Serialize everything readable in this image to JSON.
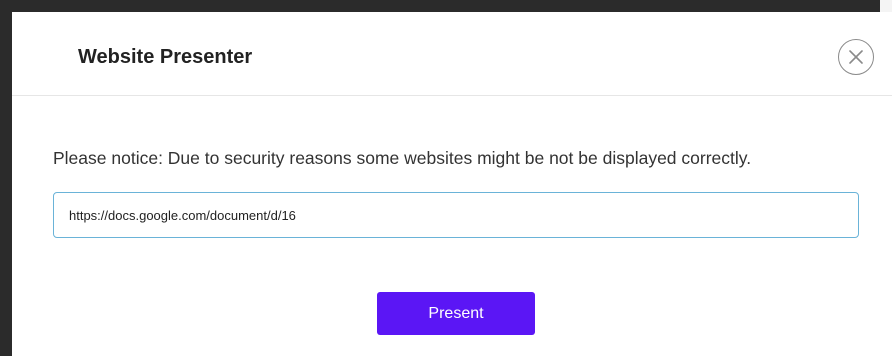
{
  "dialog": {
    "title": "Website Presenter",
    "close_icon": "close-circle-icon"
  },
  "notice": {
    "text": "Please notice: Due to security reasons some websites might be not be displayed correctly."
  },
  "url_input": {
    "value": "https://docs.google.com/document/d/16",
    "border_color": "#6ab3d8"
  },
  "present_button": {
    "label": "Present",
    "color": "#5b16f5"
  }
}
